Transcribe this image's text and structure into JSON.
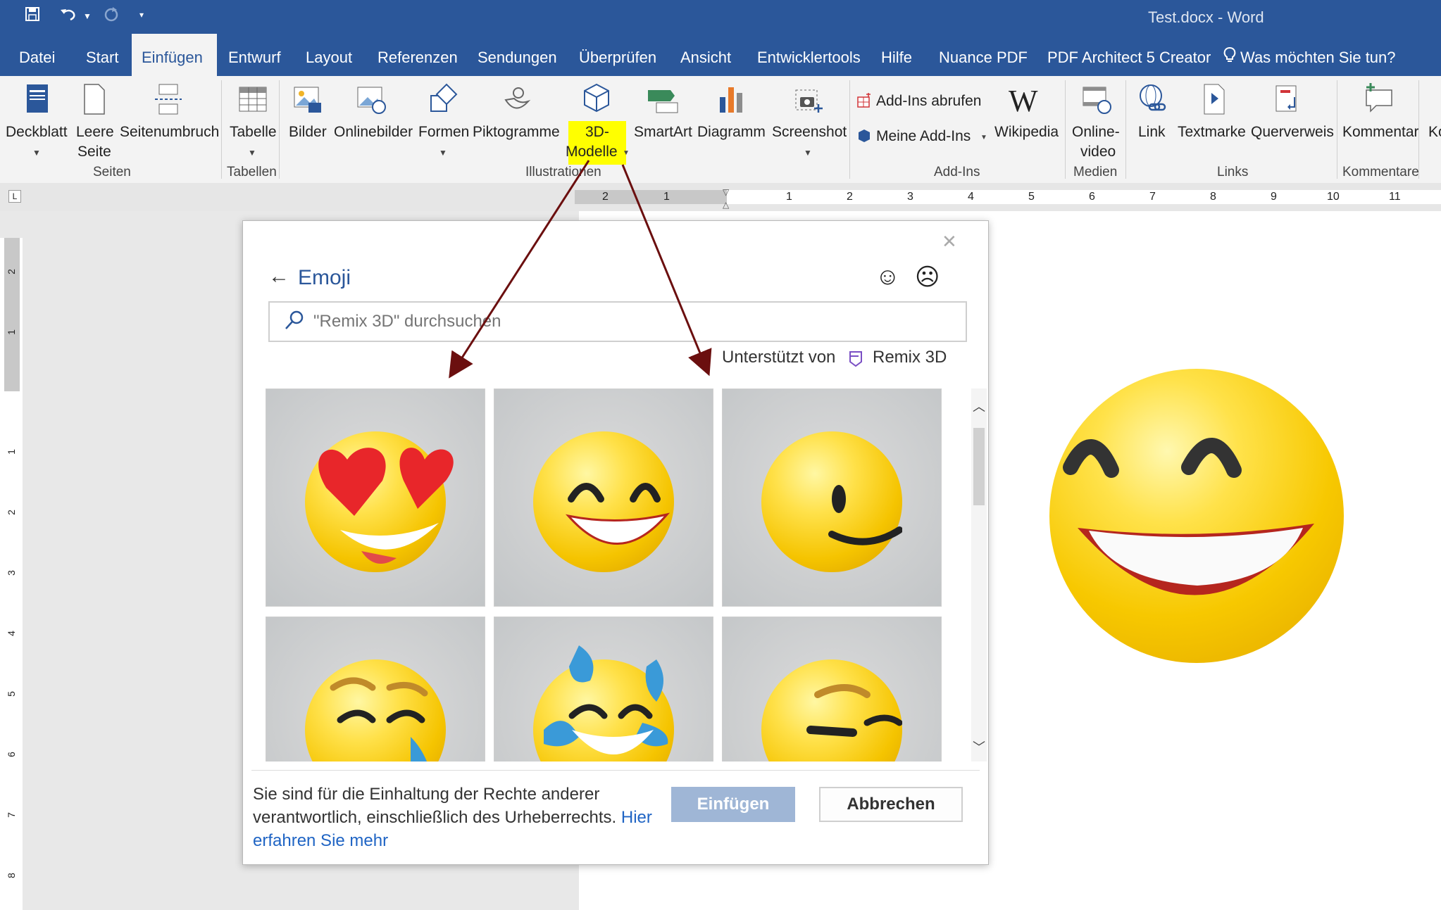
{
  "window": {
    "title": "Test.docx  -  Word"
  },
  "quick_access": {
    "save_icon": "save-icon",
    "undo_icon": "undo-icon",
    "redo_icon": "redo-icon",
    "customize_icon": "chevron-down-icon"
  },
  "tabs": [
    "Datei",
    "Start",
    "Einfügen",
    "Entwurf",
    "Layout",
    "Referenzen",
    "Sendungen",
    "Überprüfen",
    "Ansicht",
    "Entwicklertools",
    "Hilfe",
    "Nuance PDF",
    "PDF Architect 5 Creator"
  ],
  "active_tab": "Einfügen",
  "tell_me": "Was möchten Sie tun?",
  "ribbon": {
    "deckblatt": "Deckblatt",
    "leere_seite_1": "Leere",
    "leere_seite_2": "Seite",
    "seitenumbruch": "Seitenumbruch",
    "group_seiten": "Seiten",
    "tabelle": "Tabelle",
    "group_tabellen": "Tabellen",
    "bilder": "Bilder",
    "onlinebilder": "Onlinebilder",
    "formen": "Formen",
    "piktogramme": "Piktogramme",
    "modelle_1": "3D-",
    "modelle_2": "Modelle",
    "smartart": "SmartArt",
    "diagramm": "Diagramm",
    "screenshot": "Screenshot",
    "group_illustrationen": "Illustrationen",
    "addins_abrufen": "Add-Ins abrufen",
    "meine_addins": "Meine Add-Ins",
    "wikipedia": "Wikipedia",
    "group_addins": "Add-Ins",
    "onlinevideo_1": "Online-",
    "onlinevideo_2": "video",
    "group_medien": "Medien",
    "link": "Link",
    "textmarke": "Textmarke",
    "querverweis": "Querverweis",
    "group_links": "Links",
    "kommentar": "Kommentar",
    "group_kommentare": "Kommentare",
    "cut_off": "Ko"
  },
  "ruler": {
    "h_ticks": [
      "2",
      "1",
      "1",
      "2",
      "3",
      "4",
      "5",
      "6",
      "7",
      "8",
      "9",
      "10",
      "11"
    ],
    "v_ticks": [
      "2",
      "1",
      "1",
      "2",
      "3",
      "4",
      "5",
      "6",
      "7",
      "8"
    ]
  },
  "dialog": {
    "title": "Emoji",
    "search_placeholder": "\"Remix 3D\" durchsuchen",
    "supported_by": "Unterstützt von",
    "provider": "Remix 3D",
    "emoji_tiles": [
      "heart-eyes-emoji",
      "grinning-emoji",
      "smirking-emoji",
      "relieved-emoji",
      "tears-of-joy-emoji",
      "winking-emoji"
    ],
    "footer_text": "Sie sind für die Einhaltung der Rechte anderer verantwortlich, einschließlich des Urheberrechts.",
    "footer_link": "Hier erfahren Sie mehr",
    "insert_button": "Einfügen",
    "cancel_button": "Abbrechen"
  },
  "colors": {
    "accent": "#2b579a",
    "highlight": "#ffff00",
    "arrow": "#6b0f0f",
    "insert_disabled": "#9fb6d6",
    "link": "#1f64c4"
  }
}
